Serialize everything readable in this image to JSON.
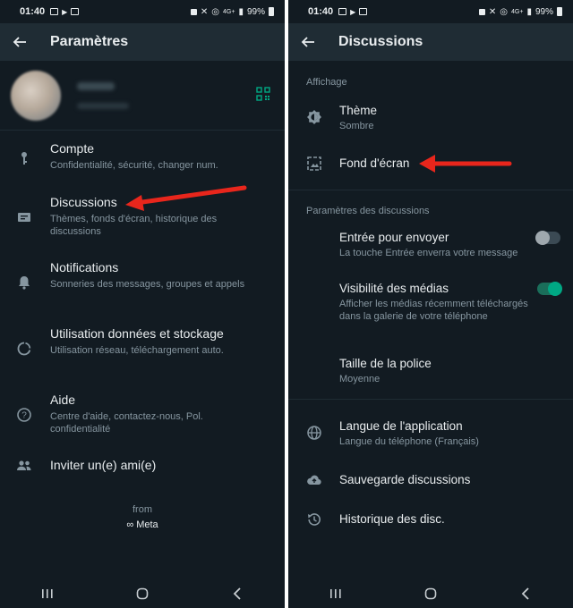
{
  "status_bar": {
    "time": "01:40",
    "battery": "99%",
    "network": "4G+"
  },
  "left": {
    "app_bar": {
      "title": "Paramètres"
    },
    "menu": [
      {
        "title": "Compte",
        "subtitle": "Confidentialité, sécurité, changer num.",
        "icon": "key-icon"
      },
      {
        "title": "Discussions",
        "subtitle": "Thèmes, fonds d'écran, historique des discussions",
        "icon": "chat-icon"
      },
      {
        "title": "Notifications",
        "subtitle": "Sonneries des messages, groupes et appels",
        "icon": "bell-icon"
      },
      {
        "title": "Utilisation données et stockage",
        "subtitle": "Utilisation réseau, téléchargement auto.",
        "icon": "data-usage-icon"
      },
      {
        "title": "Aide",
        "subtitle": "Centre d'aide, contactez-nous, Pol. confidentialité",
        "icon": "help-icon"
      },
      {
        "title": "Inviter un(e) ami(e)",
        "subtitle": "",
        "icon": "people-icon"
      }
    ],
    "footer": {
      "from": "from",
      "brand": "Meta"
    }
  },
  "right": {
    "app_bar": {
      "title": "Discussions"
    },
    "sections": {
      "display": "Affichage",
      "chat_settings": "Paramètres des discussions"
    },
    "display_items": [
      {
        "title": "Thème",
        "subtitle": "Sombre",
        "icon": "brightness-icon"
      },
      {
        "title": "Fond d'écran",
        "subtitle": "",
        "icon": "wallpaper-icon"
      }
    ],
    "chat_items": [
      {
        "title": "Entrée pour envoyer",
        "subtitle": "La touche Entrée enverra votre message",
        "toggle": false
      },
      {
        "title": "Visibilité des médias",
        "subtitle": "Afficher les médias récemment téléchargés dans la galerie de votre téléphone",
        "toggle": true
      },
      {
        "title": "Taille de la police",
        "subtitle": "Moyenne"
      }
    ],
    "other_items": [
      {
        "title": "Langue de l'application",
        "subtitle": "Langue du téléphone (Français)",
        "icon": "globe-icon"
      },
      {
        "title": "Sauvegarde discussions",
        "subtitle": "",
        "icon": "cloud-upload-icon"
      },
      {
        "title": "Historique des disc.",
        "subtitle": "",
        "icon": "history-icon"
      }
    ]
  },
  "colors": {
    "background": "#121b22",
    "app_bar": "#1f2c34",
    "accent": "#00a884",
    "text_primary": "#e9edef",
    "text_secondary": "#8696a0",
    "annotation_arrow": "#e8261c"
  }
}
